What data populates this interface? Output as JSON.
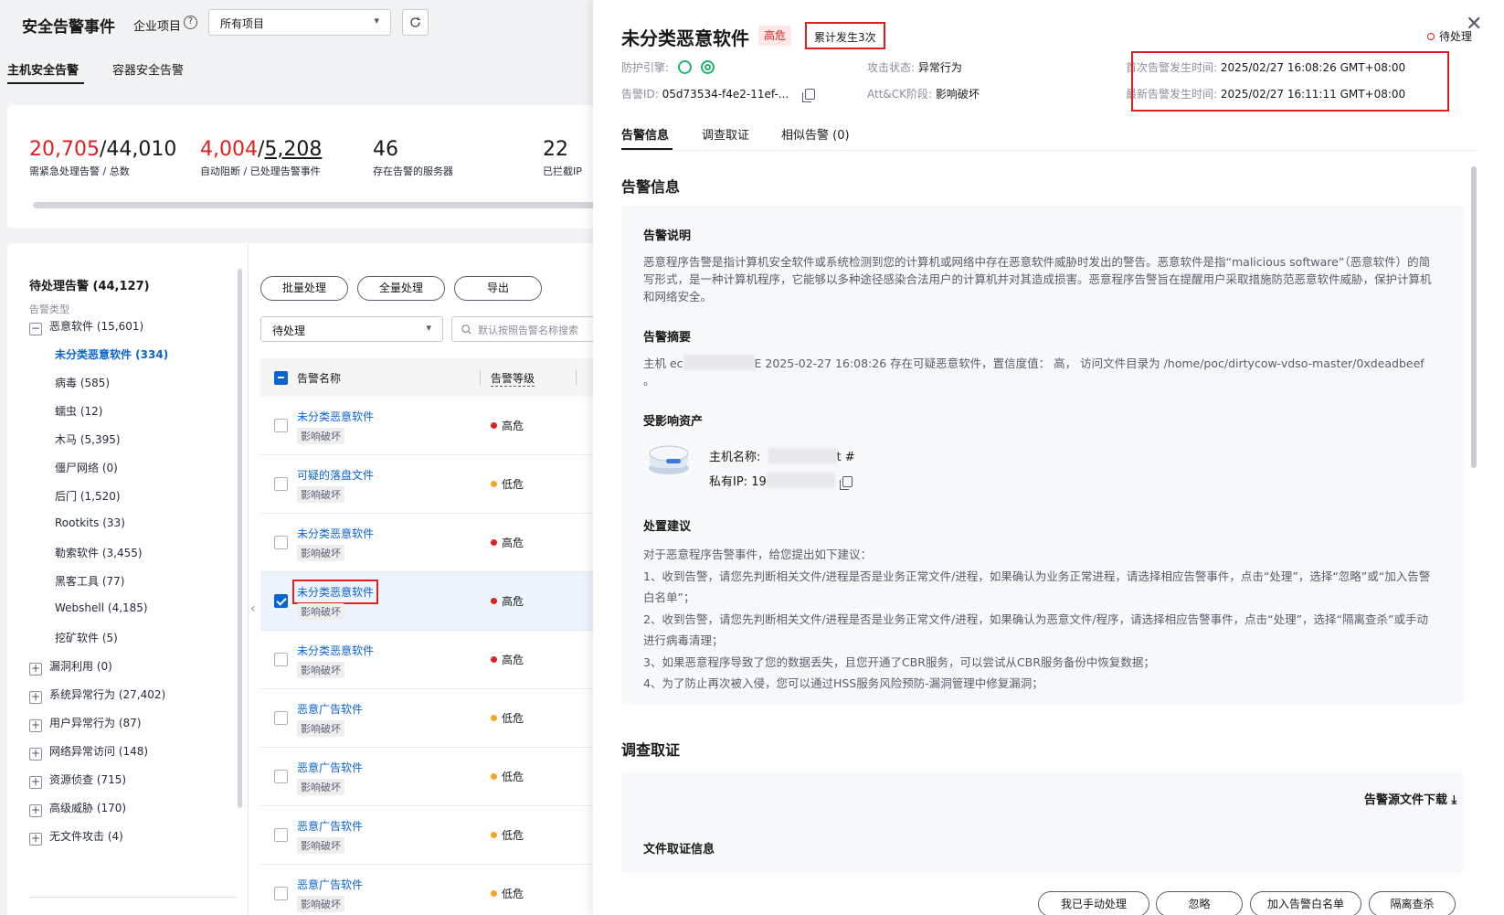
{
  "header": {
    "title": "安全告警事件",
    "project_label": "企业项目",
    "project_select": "所有项目",
    "tabs": [
      {
        "label": "主机安全告警",
        "active": true
      },
      {
        "label": "容器安全告警",
        "active": false
      }
    ]
  },
  "stats": [
    {
      "main": "20,705",
      "sep": "/",
      "total": "44,010",
      "label": "需紧急处理告警 / 总数"
    },
    {
      "main": "4,004",
      "sep": "/",
      "total": "5,208",
      "label": "自动阻断 / 已处理告警事件"
    },
    {
      "main": "46",
      "label": "存在告警的服务器"
    },
    {
      "main": "22",
      "label": "已拦截IP"
    }
  ],
  "tree": {
    "title": "待处理告警 (44,127)",
    "subtitle": "告警类型",
    "groups": [
      {
        "label": "恶意软件 (15,601)",
        "expanded": true
      },
      {
        "label": "漏洞利用 (0)"
      },
      {
        "label": "系统异常行为 (27,402)"
      },
      {
        "label": "用户异常行为 (87)"
      },
      {
        "label": "网络异常访问 (148)"
      },
      {
        "label": "资源侦查 (715)"
      },
      {
        "label": "高级威胁 (170)"
      },
      {
        "label": "无文件攻击 (4)"
      }
    ],
    "children": [
      {
        "label": "未分类恶意软件 (334)",
        "selected": true
      },
      {
        "label": "病毒 (585)"
      },
      {
        "label": "蠕虫 (12)"
      },
      {
        "label": "木马 (5,395)"
      },
      {
        "label": "僵尸网络 (0)"
      },
      {
        "label": "后门 (1,520)"
      },
      {
        "label": "Rootkits (33)"
      },
      {
        "label": "勒索软件 (3,455)"
      },
      {
        "label": "黑客工具 (77)"
      },
      {
        "label": "Webshell (4,185)"
      },
      {
        "label": "挖矿软件 (5)"
      }
    ]
  },
  "toolbar": {
    "batch": "批量处理",
    "all": "全量处理",
    "export": "导出",
    "status_filter": "待处理",
    "search_placeholder": "默认按照告警名称搜索"
  },
  "table": {
    "headers": [
      "告警名称",
      "告警等级"
    ],
    "rows": [
      {
        "name": "未分类恶意软件",
        "tag": "影响破坏",
        "level": "高危",
        "checked": false
      },
      {
        "name": "可疑的落盘文件",
        "tag": "影响破坏",
        "level": "低危",
        "checked": false
      },
      {
        "name": "未分类恶意软件",
        "tag": "影响破坏",
        "level": "高危",
        "checked": false
      },
      {
        "name": "未分类恶意软件",
        "tag": "影响破坏",
        "level": "高危",
        "checked": true
      },
      {
        "name": "未分类恶意软件",
        "tag": "影响破坏",
        "level": "高危",
        "checked": false
      },
      {
        "name": "恶意广告软件",
        "tag": "影响破坏",
        "level": "低危",
        "checked": false
      },
      {
        "name": "恶意广告软件",
        "tag": "影响破坏",
        "level": "低危",
        "checked": false
      },
      {
        "name": "恶意广告软件",
        "tag": "影响破坏",
        "level": "低危",
        "checked": false
      },
      {
        "name": "恶意广告软件",
        "tag": "影响破坏",
        "level": "低危",
        "checked": false
      }
    ]
  },
  "drawer": {
    "title": "未分类恶意软件",
    "severity": "高危",
    "occurrences": "累计发生3次",
    "status": "待处理",
    "engine_label": "防护引擎:",
    "alarm_id_label": "告警ID:",
    "alarm_id": "05d73534-f4e2-11ef-...",
    "attack_state_label": "攻击状态:",
    "attack_state": "异常行为",
    "attck_label": "Att&CK阶段:",
    "attck_stage": "影响破坏",
    "first_time_label": "首次告警发生时间:",
    "first_time": "2025/02/27 16:08:26 GMT+08:00",
    "last_time_label": "最新告警发生时间:",
    "last_time": "2025/02/27 16:11:11 GMT+08:00",
    "tabs": [
      "告警信息",
      "调查取证",
      "相似告警 (0)"
    ],
    "section_info": "告警信息",
    "desc_title": "告警说明",
    "desc_text": "恶意程序告警是指计算机安全软件或系统检测到您的计算机或网络中存在恶意软件威胁时发出的警告。恶意软件是指“malicious software”（恶意软件）的简写形式，是一种计算机程序，它能够以多种途径感染合法用户的计算机并对其造成损害。恶意程序告警旨在提醒用户采取措施防范恶意软件威胁，保护计算机和网络安全。",
    "summary_title": "告警摘要",
    "summary_prefix": "主机 ec",
    "summary_text": "E 2025-02-27 16:08:26 存在可疑恶意软件，置信度值： 高， 访问文件目录为 /home/poc/dirtycow-vdso-master/0xdeadbeef 。",
    "asset_title": "受影响资产",
    "host_label": "主机名称:",
    "host_suffix": "t #",
    "ip_label": "私有IP:",
    "ip_prefix": "19",
    "advice_title": "处置建议",
    "advice_lines": [
      "对于恶意程序告警事件，给您提出如下建议：",
      "1、收到告警，请您先判断相关文件/进程是否是业务正常文件/进程，如果确认为业务正常进程，请选择相应告警事件，点击“处理”，选择“忽略”或“加入告警白名单”；",
      "2、收到告警，请您先判断相关文件/进程是否是业务正常文件/进程，如果确认为恶意文件/程序，请选择相应告警事件，点击“处理”，选择“隔离查杀”或手动进行病毒清理；",
      "3、如果恶意程序导致了您的数据丢失，且您开通了CBR服务，可以尝试从CBR服务备份中恢复数据；",
      "4、为了防止再次被入侵，您可以通过HSS服务风险预防-漏洞管理中修复漏洞；"
    ],
    "section_forensics": "调查取证",
    "download_label": "告警源文件下载",
    "file_info_title": "文件取证信息",
    "footer": [
      "我已手动处理",
      "忽略",
      "加入告警白名单",
      "隔离查杀"
    ]
  },
  "colors": {
    "brand_blue": "#0b64cf",
    "danger_red": "#e02020",
    "warning_orange": "#f5a623"
  }
}
